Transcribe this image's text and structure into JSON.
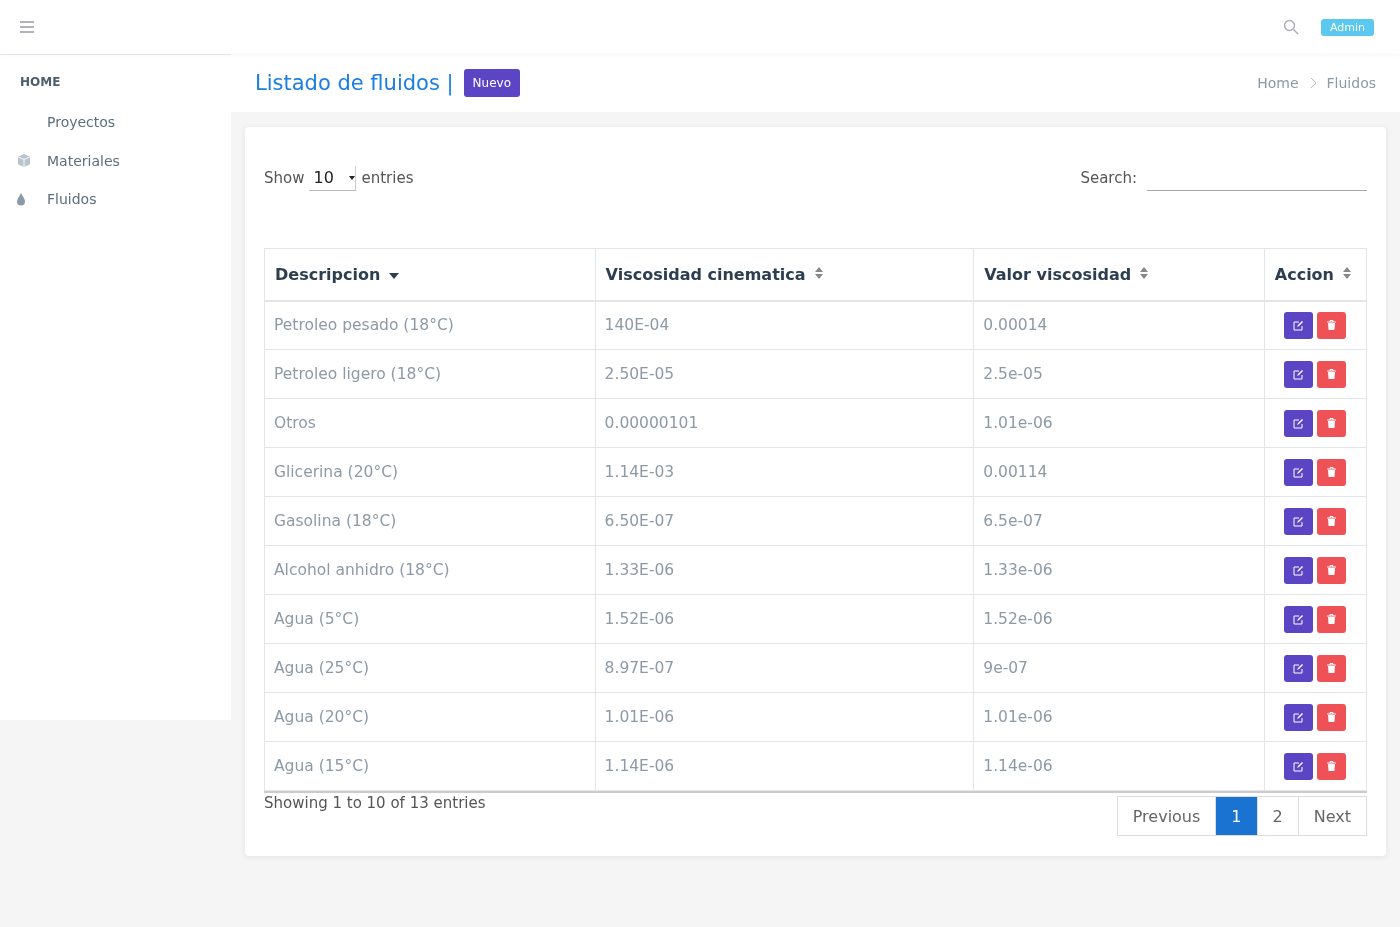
{
  "topbar": {
    "user_badge": "Admin"
  },
  "sidebar": {
    "heading": "HOME",
    "items": [
      {
        "label": "Proyectos"
      },
      {
        "label": "Materiales"
      },
      {
        "label": "Fluidos"
      }
    ]
  },
  "page_header": {
    "title": "Listado de fluidos |",
    "new_button": "Nuevo",
    "breadcrumb": [
      "Home",
      "Fluidos"
    ]
  },
  "table_controls": {
    "show_label": "Show",
    "page_size": "10",
    "entries_label": "entries",
    "search_label": "Search:"
  },
  "table": {
    "columns": [
      {
        "label": "Descripcion",
        "sorted": true
      },
      {
        "label": "Viscosidad cinematica",
        "sorted": false
      },
      {
        "label": "Valor viscosidad",
        "sorted": false
      },
      {
        "label": "Accion",
        "sorted": false
      }
    ],
    "rows": [
      [
        "Petroleo pesado (18°C)",
        "140E-04",
        "0.00014"
      ],
      [
        "Petroleo ligero (18°C)",
        "2.50E-05",
        "2.5e-05"
      ],
      [
        "Otros",
        "0.00000101",
        "1.01e-06"
      ],
      [
        "Glicerina (20°C)",
        "1.14E-03",
        "0.00114"
      ],
      [
        "Gasolina (18°C)",
        "6.50E-07",
        "6.5e-07"
      ],
      [
        "Alcohol anhidro (18°C)",
        "1.33E-06",
        "1.33e-06"
      ],
      [
        "Agua (5°C)",
        "1.52E-06",
        "1.52e-06"
      ],
      [
        "Agua (25°C)",
        "8.97E-07",
        "9e-07"
      ],
      [
        "Agua (20°C)",
        "1.01E-06",
        "1.01e-06"
      ],
      [
        "Agua (15°C)",
        "1.14E-06",
        "1.14e-06"
      ]
    ]
  },
  "footer": {
    "info": "Showing 1 to 10 of 13 entries",
    "pagination": [
      {
        "label": "Previous",
        "selected": false
      },
      {
        "label": "1",
        "selected": true
      },
      {
        "label": "2",
        "selected": false
      },
      {
        "label": "Next",
        "selected": false
      }
    ]
  }
}
